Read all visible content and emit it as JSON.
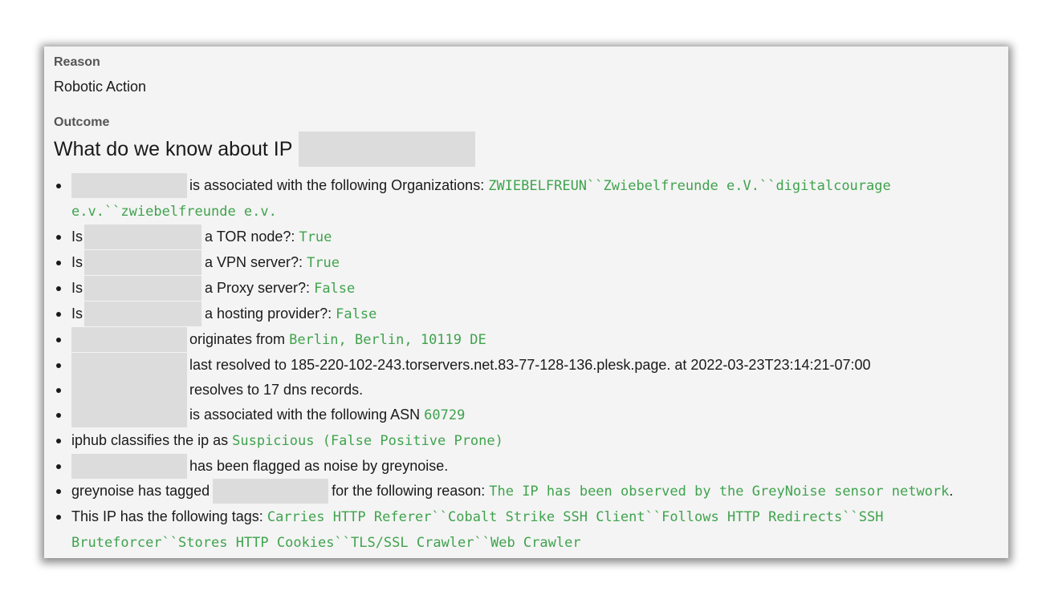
{
  "reason": {
    "label": "Reason",
    "value": "Robotic Action"
  },
  "outcome": {
    "label": "Outcome",
    "heading": "What do we know about IP"
  },
  "facts": {
    "orgs_text": "is associated with the following Organizations:",
    "orgs_value": "ZWIEBELFREUN``Zwiebelfreunde e.V.``digitalcourage e.v.``zwiebelfreunde e.v.",
    "is_label": "Is",
    "tor_text": "a TOR node?:",
    "tor_value": "True",
    "vpn_text": "a VPN server?:",
    "vpn_value": "True",
    "proxy_text": "a Proxy server?:",
    "proxy_value": "False",
    "hosting_text": "a hosting provider?:",
    "hosting_value": "False",
    "origin_text": "originates from",
    "origin_value": "Berlin, Berlin, 10119 DE",
    "resolved_text": "last resolved to 185-220-102-243.torservers.net.83-77-128-136.plesk.page. at 2022-03-23T23:14:21-07:00",
    "dns_text": "resolves to 17 dns records.",
    "asn_text": "is associated with the following ASN",
    "asn_value": "60729",
    "iphub_text": "iphub classifies the ip as",
    "iphub_value": "Suspicious (False Positive Prone)",
    "noise_text": "has been flagged as noise by greynoise.",
    "grey_tag_pre": "greynoise has tagged",
    "grey_tag_mid": "for the following reason:",
    "grey_tag_value": "The IP has been observed by the GreyNoise sensor network",
    "grey_tag_end": ".",
    "tags_text": "This IP has the following tags:",
    "tags_value": "Carries HTTP Referer``Cobalt Strike SSH Client``Follows HTTP Redirects``SSH Bruteforcer``Stores HTTP Cookies``TLS/SSL Crawler``Web Crawler"
  },
  "colors": {
    "value_green": "#3fa34d",
    "redaction_grey": "#dcdcdc",
    "card_bg": "#f4f4f4"
  }
}
